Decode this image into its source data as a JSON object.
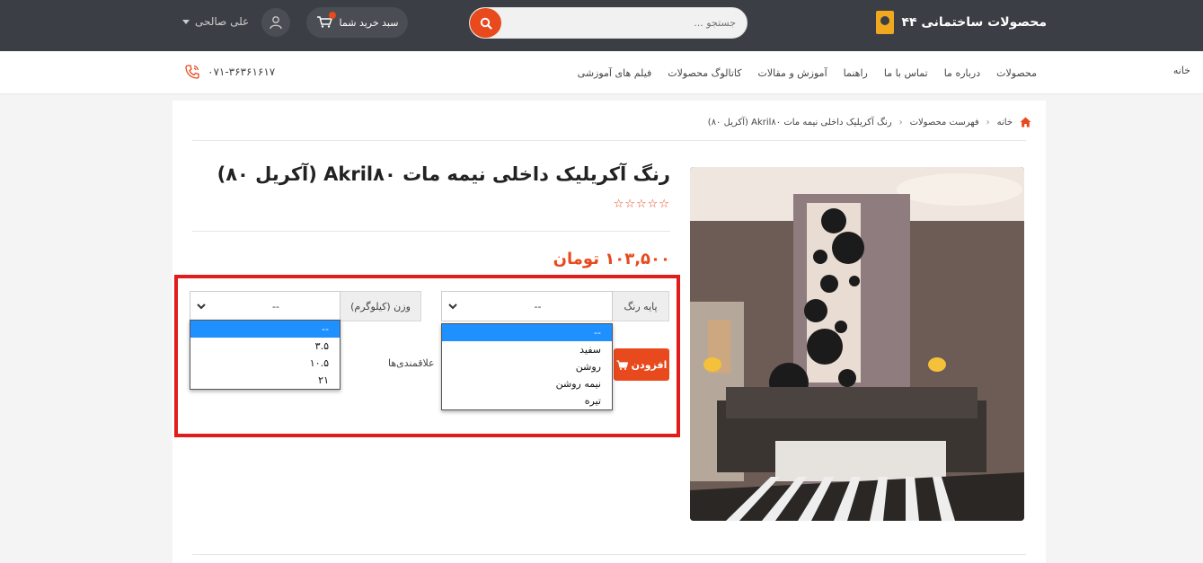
{
  "header": {
    "brand": "محصولات ساختمانی ۴۴",
    "search": {
      "placeholder": "جستجو ..."
    },
    "cart_label": "سبد خرید شما",
    "user_name": "علی صالحی"
  },
  "nav": {
    "items": [
      "خانه",
      "محصولات",
      "درباره ما",
      "تماس با ما",
      "راهنما",
      "آموزش و مقالات",
      "کاتالوگ محصولات",
      "فیلم های آموزشی"
    ],
    "phone": "۰۷۱-۳۶۳۶۱۶۱۷"
  },
  "breadcrumb": {
    "home": "خانه",
    "list": "فهرست محصولات",
    "current": "رنگ آکریلیک داخلی نیمه مات Akril۸۰ (آکریل ۸۰)"
  },
  "product": {
    "title": "رنگ آکریلیک داخلی نیمه مات Akril۸۰ (آکریل ۸۰)",
    "stars": "☆☆☆☆☆",
    "price": "۱۰۳,۵۰۰ تومان"
  },
  "options": {
    "base_label": "پایه رنگ",
    "base_value": "--",
    "base_options": [
      "--",
      "سفید",
      "روشن",
      "نیمه روشن",
      "تیره"
    ],
    "weight_label": "وزن (کیلوگرم)",
    "weight_value": "--",
    "weight_options": [
      "--",
      "۳.۵",
      "۱۰.۵",
      "۲۱"
    ]
  },
  "actions": {
    "add_label": "افزودن",
    "wishlist_label": "علاقمندی‌ها"
  },
  "colors": {
    "accent": "#e8491d",
    "header_bg": "#3b3e44",
    "highlight": "#e21b1b",
    "dropdown_selected": "#1e90ff"
  }
}
